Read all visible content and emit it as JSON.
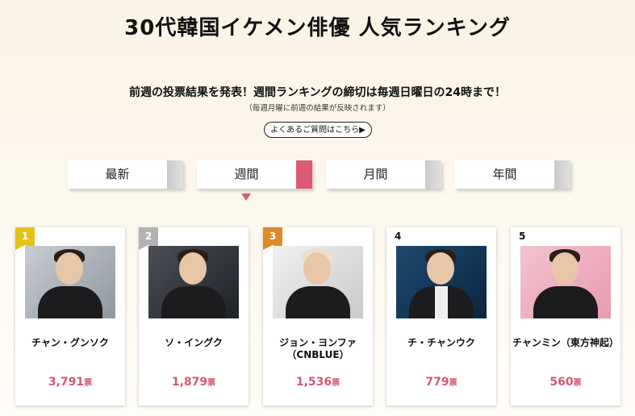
{
  "header": {
    "title": "30代韓国イケメン俳優 人気ランキング",
    "announcement": "前週の投票結果を発表！週間ランキングの締切は毎週日曜日の24時まで！",
    "note": "（毎週月曜に前週の結果が反映されます）",
    "faq_link": "よくあるご質問はこちら▶"
  },
  "tabs": [
    {
      "label": "最新",
      "active": false
    },
    {
      "label": "週間",
      "active": true
    },
    {
      "label": "月間",
      "active": false
    },
    {
      "label": "年間",
      "active": false
    }
  ],
  "vote_unit": "票",
  "ranking": [
    {
      "rank": "1",
      "name": "チャン・グンソク",
      "votes": "3,791",
      "badge_color": "#e3c21a"
    },
    {
      "rank": "2",
      "name": "ソ・イングク",
      "votes": "1,879",
      "badge_color": "#b3b3b3"
    },
    {
      "rank": "3",
      "name": "ジョン・ヨンファ（CNBLUE）",
      "votes": "1,536",
      "badge_color": "#de8a28"
    },
    {
      "rank": "4",
      "name": "チ・チャンウク",
      "votes": "779",
      "badge_color": ""
    },
    {
      "rank": "5",
      "name": "チャンミン（東方神起）",
      "votes": "560",
      "badge_color": ""
    }
  ]
}
